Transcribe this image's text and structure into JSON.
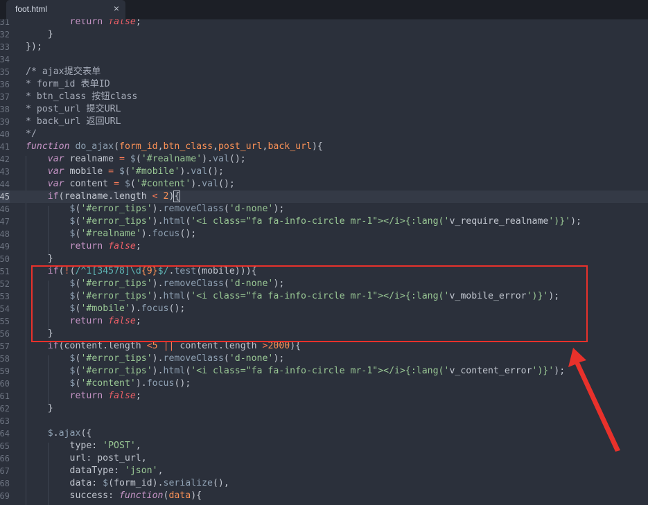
{
  "tab": {
    "title": "foot.html",
    "close_symbol": "×"
  },
  "lines": [
    {
      "n": "31",
      "html": "        <span class='c-kw2'>return</span> <span class='c-bool'>false</span>;"
    },
    {
      "n": "32",
      "html": "    }"
    },
    {
      "n": "33",
      "html": "});"
    },
    {
      "n": "34",
      "html": ""
    },
    {
      "n": "35",
      "html": "<span class='c-cm'>/* ajax提交表单</span>"
    },
    {
      "n": "36",
      "html": "<span class='c-cm'>* form_id 表单ID</span>"
    },
    {
      "n": "37",
      "html": "<span class='c-cm'>* btn_class 按钮class</span>"
    },
    {
      "n": "38",
      "html": "<span class='c-cm'>* post_url 提交URL</span>"
    },
    {
      "n": "39",
      "html": "<span class='c-cm'>* back_url 返回URL</span>"
    },
    {
      "n": "40",
      "html": "<span class='c-cm'>*/</span>"
    },
    {
      "n": "41",
      "html": "<span class='c-kw'>function</span> <span class='c-fn'>do_ajax</span>(<span class='c-param'>form_id</span>,<span class='c-param'>btn_class</span>,<span class='c-param'>post_url</span>,<span class='c-param'>back_url</span>){"
    },
    {
      "n": "42",
      "html": "    <span class='c-kw'>var</span> realname <span class='c-op'>=</span> <span class='c-fn'>$</span>(<span class='c-str'>'#realname'</span>).<span class='c-fn'>val</span>();"
    },
    {
      "n": "43",
      "html": "    <span class='c-kw'>var</span> mobile <span class='c-op'>=</span> <span class='c-fn'>$</span>(<span class='c-str'>'#mobile'</span>).<span class='c-fn'>val</span>();"
    },
    {
      "n": "44",
      "html": "    <span class='c-kw'>var</span> content <span class='c-op'>=</span> <span class='c-fn'>$</span>(<span class='c-str'>'#content'</span>).<span class='c-fn'>val</span>();"
    },
    {
      "n": "45",
      "html": "    <span class='c-kw2'>if</span>(realname.length <span class='c-op'>&lt;</span> <span class='c-num'>2</span>)<span style='outline:1px solid #c0c5ce'>{</span>",
      "active": true
    },
    {
      "n": "46",
      "html": "        <span class='c-fn'>$</span>(<span class='c-str'>'#error_tips'</span>).<span class='c-fn'>removeClass</span>(<span class='c-str'>'d-none'</span>);"
    },
    {
      "n": "47",
      "html": "        <span class='c-fn'>$</span>(<span class='c-str'>'#error_tips'</span>).<span class='c-fn'>html</span>(<span class='c-str'>'&lt;i class=\"fa fa-info-circle mr-1\"&gt;&lt;/i&gt;{:lang('</span>v_require_realname<span class='c-str'>')}'</span>);"
    },
    {
      "n": "48",
      "html": "        <span class='c-fn'>$</span>(<span class='c-str'>'#realname'</span>).<span class='c-fn'>focus</span>();"
    },
    {
      "n": "49",
      "html": "        <span class='c-kw2'>return</span> <span class='c-bool'>false</span>;"
    },
    {
      "n": "50",
      "html": "    }"
    },
    {
      "n": "51",
      "html": "    <span class='c-kw2'>if</span>(<span class='c-op'>!</span>(<span class='c-re'>/^1[34578]\\d</span><span class='c-reg'>{9}</span><span class='c-re'>$/</span>.<span class='c-fn'>test</span>(mobile))){"
    },
    {
      "n": "52",
      "html": "        <span class='c-fn'>$</span>(<span class='c-str'>'#error_tips'</span>).<span class='c-fn'>removeClass</span>(<span class='c-str'>'d-none'</span>);"
    },
    {
      "n": "53",
      "html": "        <span class='c-fn'>$</span>(<span class='c-str'>'#error_tips'</span>).<span class='c-fn'>html</span>(<span class='c-str'>'&lt;i class=\"fa fa-info-circle mr-1\"&gt;&lt;/i&gt;{:lang('</span>v_mobile_error<span class='c-str'>')}'</span>);"
    },
    {
      "n": "54",
      "html": "        <span class='c-fn'>$</span>(<span class='c-str'>'#mobile'</span>).<span class='c-fn'>focus</span>();"
    },
    {
      "n": "55",
      "html": "        <span class='c-kw2'>return</span> <span class='c-bool'>false</span>;"
    },
    {
      "n": "56",
      "html": "    }"
    },
    {
      "n": "57",
      "html": "    <span class='c-kw2'>if</span>(content.length <span class='c-op'>&lt;</span><span class='c-num'>5</span> <span class='c-op'>||</span> content.length <span class='c-op'>&gt;</span><span class='c-num'>2000</span>){"
    },
    {
      "n": "58",
      "html": "        <span class='c-fn'>$</span>(<span class='c-str'>'#error_tips'</span>).<span class='c-fn'>removeClass</span>(<span class='c-str'>'d-none'</span>);"
    },
    {
      "n": "59",
      "html": "        <span class='c-fn'>$</span>(<span class='c-str'>'#error_tips'</span>).<span class='c-fn'>html</span>(<span class='c-str'>'&lt;i class=\"fa fa-info-circle mr-1\"&gt;&lt;/i&gt;{:lang('</span>v_content_error<span class='c-str'>')}'</span>);"
    },
    {
      "n": "60",
      "html": "        <span class='c-fn'>$</span>(<span class='c-str'>'#content'</span>).<span class='c-fn'>focus</span>();"
    },
    {
      "n": "61",
      "html": "        <span class='c-kw2'>return</span> <span class='c-bool'>false</span>;"
    },
    {
      "n": "62",
      "html": "    }"
    },
    {
      "n": "63",
      "html": ""
    },
    {
      "n": "64",
      "html": "    <span class='c-fn'>$</span>.<span class='c-fn'>ajax</span>({"
    },
    {
      "n": "65",
      "html": "        type: <span class='c-str'>'POST'</span>,"
    },
    {
      "n": "66",
      "html": "        url: post_url,"
    },
    {
      "n": "67",
      "html": "        dataType: <span class='c-str'>'json'</span>,"
    },
    {
      "n": "68",
      "html": "        data: <span class='c-fn'>$</span>(form_id).<span class='c-fn'>serialize</span>(),"
    },
    {
      "n": "69",
      "html": "        success: <span class='c-kw'>function</span>(<span class='c-param'>data</span>){"
    }
  ],
  "colors": {
    "background": "#2b303b",
    "tabbar": "#1c1f26",
    "highlight_box": "#e8312b",
    "arrow": "#e8312b"
  }
}
